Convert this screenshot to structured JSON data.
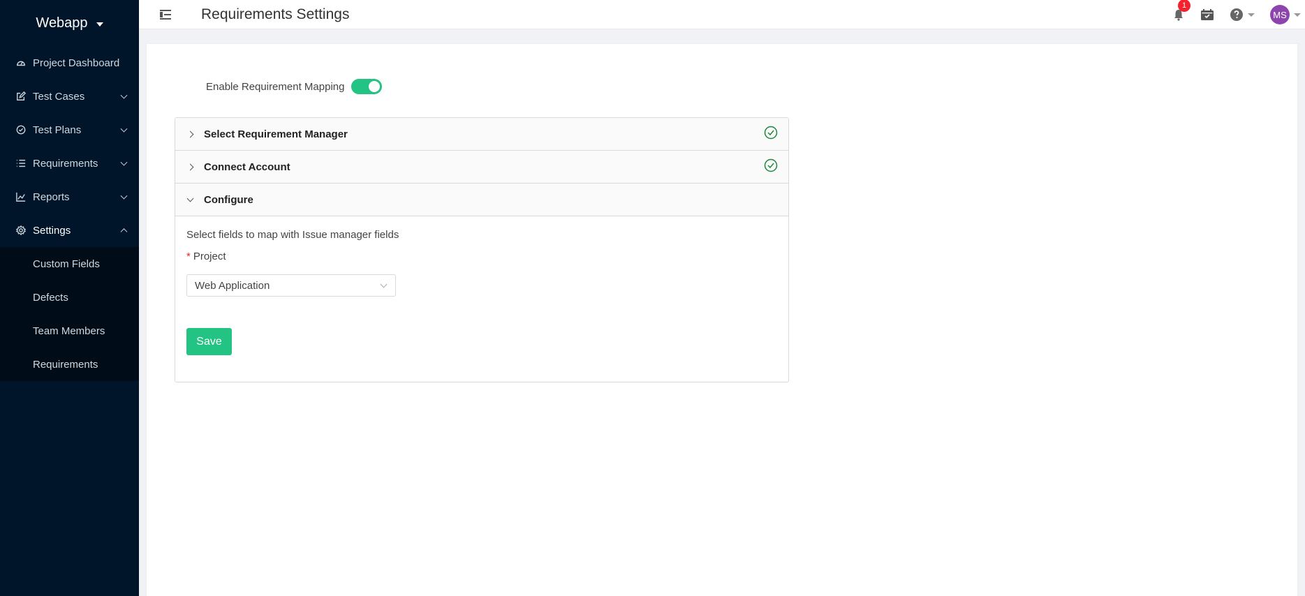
{
  "sidebar": {
    "brand": "Webapp",
    "items": [
      {
        "label": "Project Dashboard",
        "icon": "dashboard-icon"
      },
      {
        "label": "Test Cases",
        "icon": "edit-icon"
      },
      {
        "label": "Test Plans",
        "icon": "check-circle-icon"
      },
      {
        "label": "Requirements",
        "icon": "list-icon"
      },
      {
        "label": "Reports",
        "icon": "line-chart-icon"
      },
      {
        "label": "Settings",
        "icon": "gear-icon"
      }
    ],
    "settings_sub": [
      {
        "label": "Custom Fields"
      },
      {
        "label": "Defects"
      },
      {
        "label": "Team Members"
      },
      {
        "label": "Requirements"
      }
    ]
  },
  "header": {
    "title": "Requirements Settings",
    "notification_count": "1",
    "avatar_initials": "MS"
  },
  "main": {
    "toggle_label": "Enable Requirement Mapping",
    "toggle_on": true,
    "panels": [
      {
        "title": "Select Requirement Manager",
        "completed": true
      },
      {
        "title": "Connect Account",
        "completed": true
      },
      {
        "title": "Configure",
        "completed": false
      }
    ],
    "configure": {
      "description": "Select fields to map with Issue manager fields",
      "required_mark": "*",
      "project_label": "Project",
      "project_value": "Web Application",
      "save_label": "Save"
    }
  },
  "colors": {
    "sidebar_bg": "#001529",
    "accent": "#23c483",
    "badge": "#f5222d",
    "avatar": "#8e44ad",
    "check": "#1a8a3a"
  }
}
